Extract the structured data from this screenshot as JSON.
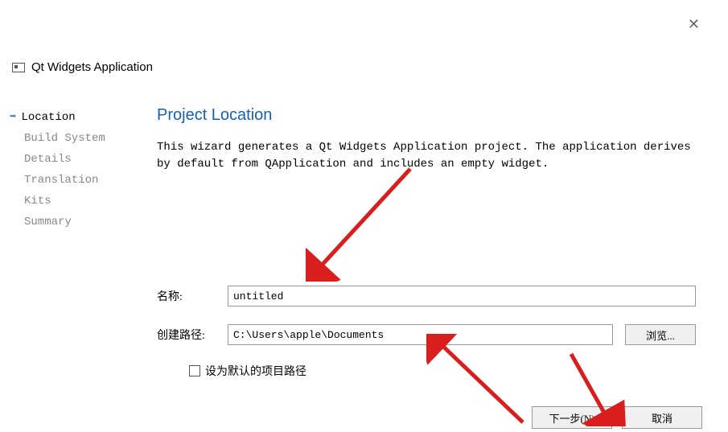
{
  "window": {
    "title": "Qt Widgets Application"
  },
  "sidebar": {
    "items": [
      {
        "label": "Location",
        "active": true
      },
      {
        "label": "Build System",
        "active": false
      },
      {
        "label": "Details",
        "active": false
      },
      {
        "label": "Translation",
        "active": false
      },
      {
        "label": "Kits",
        "active": false
      },
      {
        "label": "Summary",
        "active": false
      }
    ]
  },
  "main": {
    "heading": "Project Location",
    "description": "This wizard generates a Qt Widgets Application project. The application derives by default from QApplication and includes an empty widget."
  },
  "form": {
    "name_label": "名称:",
    "name_value": "untitled",
    "path_label": "创建路径:",
    "path_value": "C:\\Users\\apple\\Documents",
    "browse_label": "浏览...",
    "default_path_label": "设为默认的项目路径"
  },
  "buttons": {
    "next": "下一步(N)",
    "cancel": "取消"
  }
}
